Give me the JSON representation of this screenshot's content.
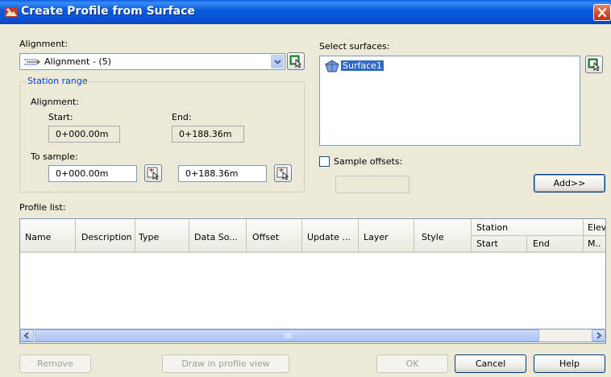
{
  "window": {
    "title": "Create Profile from Surface"
  },
  "alignment": {
    "label": "Alignment:",
    "selected": "Alignment - (5)"
  },
  "station_range": {
    "title": "Station range",
    "alignment_label": "Alignment:",
    "start_label": "Start:",
    "start_value": "0+000.00m",
    "end_label": "End:",
    "end_value": "0+188.36m",
    "to_sample_label": "To sample:",
    "sample_start": "0+000.00m",
    "sample_end": "0+188.36m"
  },
  "surfaces": {
    "label": "Select surfaces:",
    "items": [
      "Surface1"
    ],
    "selected_index": 0
  },
  "sample_offsets": {
    "label": "Sample offsets:",
    "checked": false,
    "value": ""
  },
  "add_button": "Add>>",
  "profile_list": {
    "label": "Profile list:",
    "columns": [
      "Name",
      "Description",
      "Type",
      "Data So...",
      "Offset",
      "Update ...",
      "Layer",
      "Style"
    ],
    "station_group": "Station",
    "station_sub": [
      "Start",
      "End"
    ],
    "elev_group": "Elev",
    "elev_sub": "M..",
    "rows": []
  },
  "buttons": {
    "remove": "Remove",
    "draw": "Draw in profile view",
    "ok": "OK",
    "cancel": "Cancel",
    "help": "Help"
  },
  "colors": {
    "title_bar": "#0A5FE3",
    "selection": "#316AC5",
    "group_title": "#0046D5"
  },
  "icons": [
    "app-icon",
    "close-icon",
    "alignment-icon",
    "dropdown-arrow-icon",
    "pick-from-drawing-icon",
    "surface-icon",
    "scroll-left-icon",
    "scroll-right-icon"
  ]
}
